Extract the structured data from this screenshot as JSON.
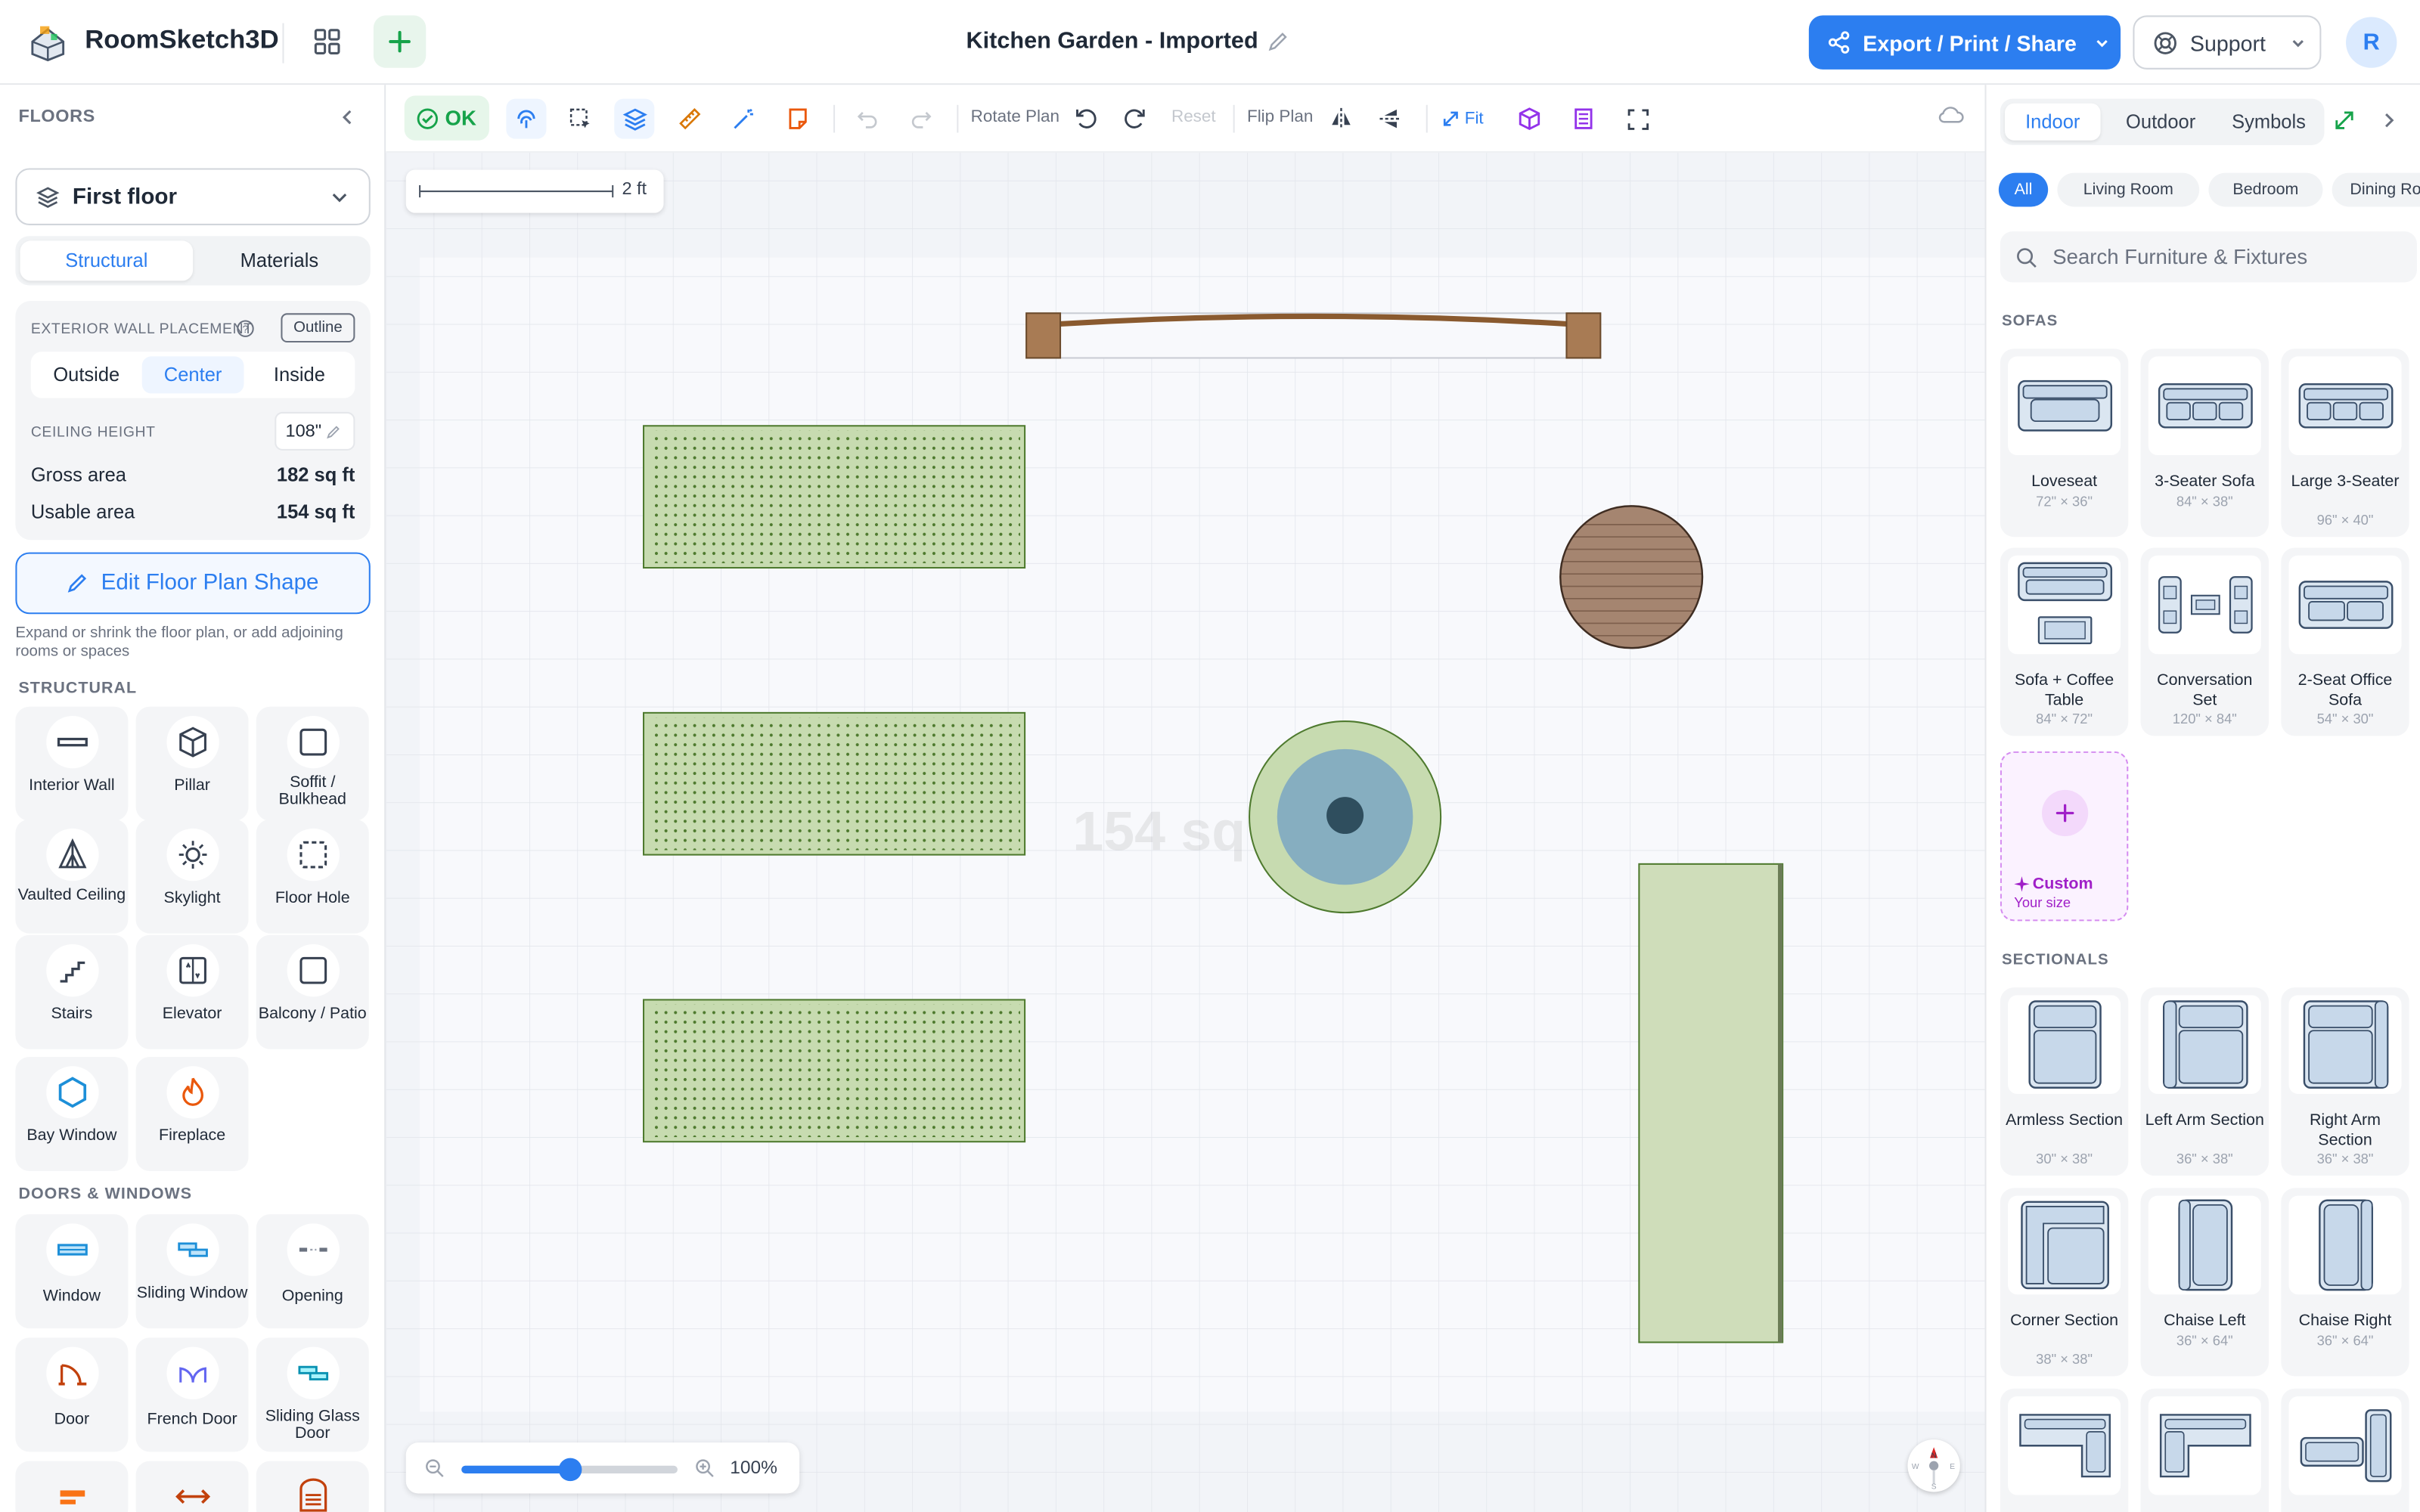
{
  "app": {
    "name": "RoomSketch3D",
    "title": "Kitchen Garden - Imported",
    "export_label": "Export / Print / Share",
    "support_label": "Support",
    "avatar_initial": "R"
  },
  "left_panel": {
    "header": "FLOORS",
    "floor_select": "First floor",
    "tabs": [
      "Structural",
      "Materials"
    ],
    "active_tab": "Structural",
    "exterior_wall_label": "EXTERIOR WALL PLACEMENT",
    "outline_label": "Outline",
    "placement_options": [
      "Outside",
      "Center",
      "Inside"
    ],
    "active_placement": "Center",
    "ceiling_label": "CEILING HEIGHT",
    "ceiling_value": "108\"",
    "gross_area_label": "Gross area",
    "gross_area_value": "182 sq ft",
    "usable_area_label": "Usable area",
    "usable_area_value": "154 sq ft",
    "edit_button": "Edit Floor Plan Shape",
    "hint": "Expand or shrink the floor plan, or add adjoining rooms or spaces",
    "structural_header": "STRUCTURAL",
    "structural_items": [
      "Interior Wall",
      "Pillar",
      "Soffit / Bulkhead",
      "Vaulted Ceiling",
      "Skylight",
      "Floor Hole",
      "Stairs",
      "Elevator",
      "Balcony / Patio",
      "Bay Window",
      "Fireplace"
    ],
    "doors_header": "DOORS & WINDOWS",
    "door_items": [
      "Window",
      "Sliding Window",
      "Opening",
      "Door",
      "French Door",
      "Sliding Glass Door"
    ]
  },
  "toolbar": {
    "ok_label": "OK",
    "rotate_label": "Rotate Plan",
    "reset_label": "Reset",
    "flip_label": "Flip Plan",
    "fit_label": "Fit"
  },
  "canvas": {
    "scale_label": "2 ft",
    "area_watermark": "154 sq",
    "zoom_percent": "100%",
    "zoom_fraction": 0.5
  },
  "right_panel": {
    "tabs": [
      "Indoor",
      "Outdoor",
      "Symbols"
    ],
    "active_tab": "Indoor",
    "categories": [
      "All",
      "Living Room",
      "Bedroom",
      "Dining Room"
    ],
    "active_category": "All",
    "search_placeholder": "Search Furniture & Fixtures",
    "sofas_header": "SOFAS",
    "sofas": [
      {
        "name": "Loveseat",
        "dims": "72\" × 36\""
      },
      {
        "name": "3-Seater Sofa",
        "dims": "84\" × 38\""
      },
      {
        "name": "Large 3-Seater",
        "dims": "96\" × 40\""
      },
      {
        "name": "Sofa + Coffee Table",
        "dims": "84\" × 72\""
      },
      {
        "name": "Conversation Set",
        "dims": "120\" × 84\""
      },
      {
        "name": "2-Seat Office Sofa",
        "dims": "54\" × 30\""
      }
    ],
    "custom_label": "Custom",
    "custom_sub": "Your size",
    "sectionals_header": "SECTIONALS",
    "sectionals": [
      {
        "name": "Armless Section",
        "dims": "30\" × 38\""
      },
      {
        "name": "Left Arm Section",
        "dims": "36\" × 38\""
      },
      {
        "name": "Right Arm Section",
        "dims": "36\" × 38\""
      },
      {
        "name": "Corner Section",
        "dims": "38\" × 38\""
      },
      {
        "name": "Chaise Left",
        "dims": "36\" × 64\""
      },
      {
        "name": "Chaise Right",
        "dims": "36\" × 64\""
      }
    ]
  },
  "colors": {
    "accent": "#2c7ef0",
    "ok_green": "#16a34a",
    "bed_green": "#c7dbb0",
    "custom_purple": "#a020c8"
  }
}
